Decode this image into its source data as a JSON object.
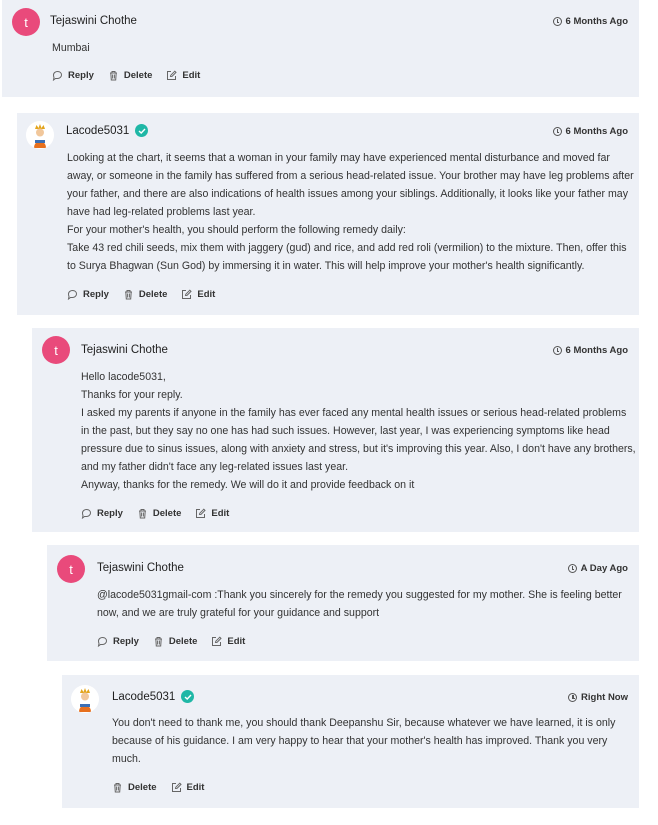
{
  "comments": [
    {
      "author": "Tejaswini Chothe",
      "avatar_letter": "t",
      "time": "6 Months Ago",
      "lines": [
        "Mumbai"
      ],
      "actions": {
        "reply": "Reply",
        "delete": "Delete",
        "edit": "Edit"
      }
    },
    {
      "author": "Lacode5031",
      "verified": true,
      "time": "6 Months Ago",
      "lines": [
        "Looking at the chart, it seems that a woman in your family may have experienced mental disturbance and moved far",
        "away, or someone in the family has suffered from a serious head-related issue. Your brother may have leg problems after",
        "your father, and there are also indications of health issues among your siblings. Additionally, it looks like your father may",
        "have had leg-related problems last year.",
        "For your mother's health, you should perform the following remedy daily:",
        "Take 43 red chili seeds, mix them with jaggery (gud) and rice, and add red roli (vermilion) to the mixture. Then, offer this",
        "to Surya Bhagwan (Sun God) by immersing it in water. This will help improve your mother's health significantly."
      ],
      "actions": {
        "reply": "Reply",
        "delete": "Delete",
        "edit": "Edit"
      }
    },
    {
      "author": "Tejaswini Chothe",
      "avatar_letter": "t",
      "time": "6 Months Ago",
      "lines": [
        "Hello lacode5031,",
        "Thanks for your reply.",
        "I asked my parents if anyone in the family has ever faced any mental health issues or serious head-related problems",
        "in the past, but they say no one has had such issues. However, last year, I was experiencing symptoms like head",
        "pressure due to sinus issues, along with anxiety and stress, but it's improving this year. Also, I don't have any brothers,",
        "and my father didn't face any leg-related issues last year.",
        "Anyway, thanks for the remedy. We will do it and provide feedback on it"
      ],
      "actions": {
        "reply": "Reply",
        "delete": "Delete",
        "edit": "Edit"
      }
    },
    {
      "author": "Tejaswini Chothe",
      "avatar_letter": "t",
      "time": "A Day Ago",
      "lines": [
        "@lacode5031gmail-com :Thank you sincerely for the remedy you suggested for my mother. She is feeling better",
        "now, and we are truly grateful for your guidance and support"
      ],
      "actions": {
        "reply": "Reply",
        "delete": "Delete",
        "edit": "Edit"
      }
    },
    {
      "author": "Lacode5031",
      "verified": true,
      "time": "Right Now",
      "lines": [
        "You don't need to thank me, you should thank Deepanshu Sir, because whatever we have learned, it is only",
        "because of his guidance. I am very happy to hear that your mother's health has improved. Thank you very",
        "much."
      ],
      "actions": {
        "delete": "Delete",
        "edit": "Edit"
      }
    }
  ],
  "colors": {
    "card_bg": "#edf0f6",
    "avatar_pink": "#e94a7b",
    "verified_teal": "#1fb7a6"
  }
}
